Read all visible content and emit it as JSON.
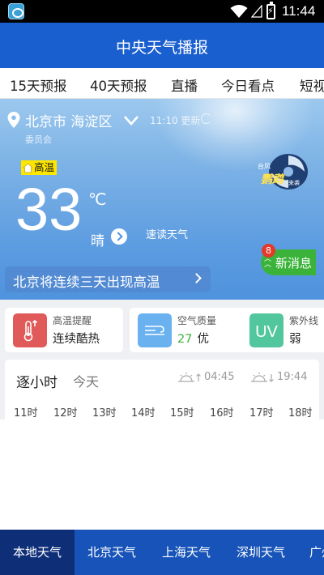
{
  "status_bar": {
    "time": "11:44",
    "icons": [
      "app-notification-icon",
      "wifi-icon",
      "signal-icon",
      "battery-charging-icon"
    ]
  },
  "header": {
    "title": "中央天气播报"
  },
  "tabs": [
    {
      "label": "15天预报"
    },
    {
      "label": "40天预报"
    },
    {
      "label": "直播"
    },
    {
      "label": "今日看点"
    },
    {
      "label": "短视"
    }
  ],
  "weather": {
    "location": "北京市 海淀区",
    "sub_location": "委员会",
    "update_time": "11:10 更新",
    "alert_label": "高温",
    "temperature": "33",
    "unit": "℃",
    "condition": "晴",
    "quick_read": "速读天气",
    "news_label": "新消息",
    "news_count": "8",
    "headline": "北京将连续三天出现高温",
    "typhoon_badge": {
      "text_top": "台风",
      "text_main": "鹦鹉",
      "text_side": "来袭"
    }
  },
  "info_cards": [
    {
      "title": "高温提醒",
      "value": "连续酷热",
      "icon": "thermometer-icon",
      "color": "#e15a5a"
    },
    {
      "title": "空气质量",
      "value_num": "27",
      "value": "优",
      "icon": "haze-icon",
      "color": "#6ab1f0"
    },
    {
      "title": "紫外线",
      "value": "弱",
      "icon": "uv-icon",
      "icon_text": "UV",
      "color": "#52c69d"
    }
  ],
  "hourly": {
    "title": "逐小时",
    "day": "今天",
    "sunrise": "04:45",
    "sunset": "19:44",
    "hours": [
      "11时",
      "12时",
      "13时",
      "14时",
      "15时",
      "16时",
      "17时",
      "18时"
    ]
  },
  "bottom_nav": [
    {
      "label": "本地天气",
      "active": true
    },
    {
      "label": "北京天气",
      "active": false
    },
    {
      "label": "上海天气",
      "active": false
    },
    {
      "label": "深圳天气",
      "active": false
    },
    {
      "label": "广州",
      "active": false
    }
  ]
}
